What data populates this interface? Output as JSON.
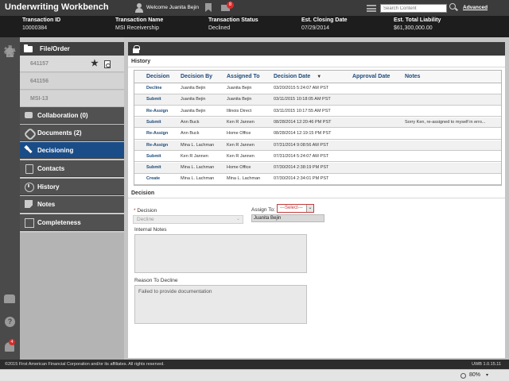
{
  "app": {
    "title": "Underwriting Workbench",
    "welcome": "Welcome Juanita Bejin",
    "mail_count": "8",
    "search_placeholder": "Search Content",
    "advanced_label": "Advanced"
  },
  "transaction": {
    "id_label": "Transaction ID",
    "id_value": "10000384",
    "name_label": "Transaction Name",
    "name_value": "MSI Receivership",
    "status_label": "Transaction Status",
    "status_value": "Declined",
    "closing_label": "Est. Closing Date",
    "closing_value": "07/29/2014",
    "liability_label": "Est. Total Liability",
    "liability_value": "$61,300,000.00"
  },
  "sidebar": {
    "file_order_label": "File/Order",
    "orders": [
      "641157",
      "641156",
      "MSI-13"
    ],
    "items": [
      {
        "label": "Collaboration (0)",
        "icon": "chat-icon"
      },
      {
        "label": "Documents (2)",
        "icon": "paperclip-icon"
      },
      {
        "label": "Decisioning",
        "icon": "gavel-icon"
      },
      {
        "label": "Contacts",
        "icon": "contacts-icon"
      },
      {
        "label": "History",
        "icon": "clock-icon"
      },
      {
        "label": "Notes",
        "icon": "note-icon"
      },
      {
        "label": "Completeness",
        "icon": "checklist-icon"
      }
    ],
    "active_item": "Decisioning",
    "notification_count": "4"
  },
  "history": {
    "title": "History",
    "columns": [
      "Decision",
      "Decision By",
      "Assigned To",
      "Decision Date",
      "Approval Date",
      "Notes"
    ],
    "rows": [
      [
        "Decline",
        "Juanita Bejin",
        "Juanita Bejin",
        "03/20/2015 5:24:07 AM PST",
        "",
        ""
      ],
      [
        "Submit",
        "Juanita Bejin",
        "Juanita Bejin",
        "03/11/2015 10:18:05 AM PST",
        "",
        ""
      ],
      [
        "Re-Assign",
        "Juanita Bejin",
        "Illinois Direct",
        "03/11/2015 10:17:55 AM PST",
        "",
        ""
      ],
      [
        "Submit",
        "Ann Buck",
        "Ken R Jannen",
        "08/28/2014 12:20:46 PM PST",
        "",
        "Sorry Ken, re-assigned to myself in erro..."
      ],
      [
        "Re-Assign",
        "Ann Buck",
        "Home Office",
        "08/28/2014 12:19:15 PM PST",
        "",
        ""
      ],
      [
        "Re-Assign",
        "Mina L. Lachman",
        "Ken R Jannen",
        "07/31/2014 9:08:56 AM PST",
        "",
        ""
      ],
      [
        "Submit",
        "Ken R Jannen",
        "Ken R Jannen",
        "07/31/2014 5:24:07 AM PST",
        "",
        ""
      ],
      [
        "Submit",
        "Mina L. Lachman",
        "Home Office",
        "07/30/2014 2:38:19 PM PST",
        "",
        ""
      ],
      [
        "Create",
        "Mina L. Lachman",
        "Mina L. Lachman",
        "07/30/2014 2:34:01 PM PST",
        "",
        ""
      ]
    ]
  },
  "decision": {
    "title": "Decision",
    "required_marker": "*",
    "decision_label": "Decision",
    "decision_value": "Decline",
    "assign_label": "Assign To:",
    "assign_select": "---Select---",
    "assign_value": "Juanita Bejin",
    "internal_notes_label": "Internal Notes",
    "internal_notes_value": "",
    "reason_label": "Reason To Decline",
    "reason_value": "Failed to provide documentation"
  },
  "footer": {
    "copyright": "©2015 First American Financial Corporation and/or its affiliates. All rights reserved.",
    "version": "UWB 1.0.15.11"
  },
  "status": {
    "zoom": "80%"
  }
}
